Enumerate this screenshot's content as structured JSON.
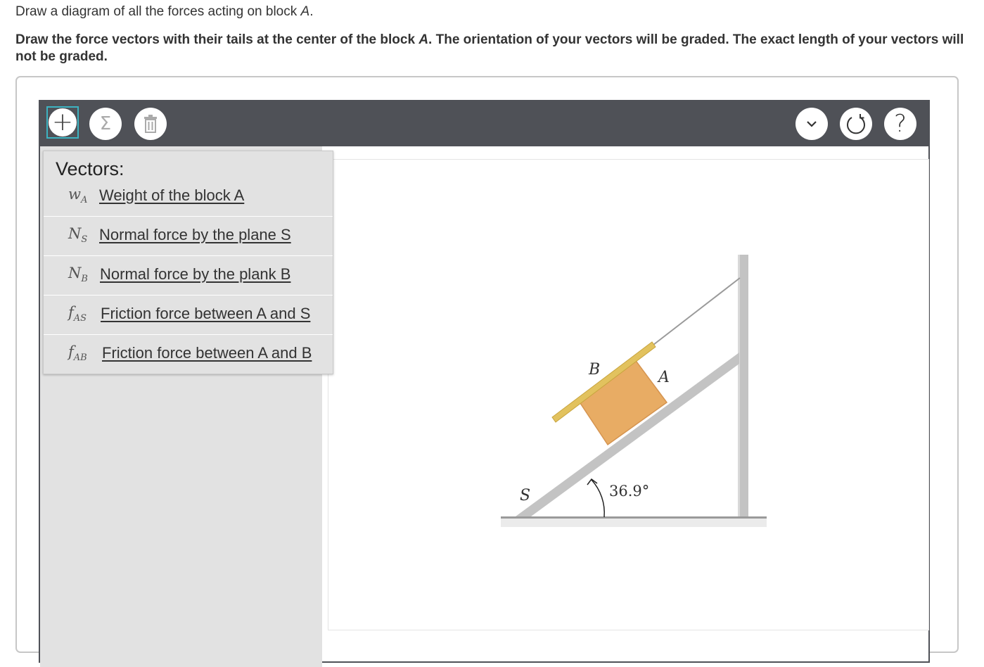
{
  "question": {
    "line1_prefix": "Draw a diagram of all the forces acting on block ",
    "line1_var": "A",
    "line1_suffix": ".",
    "line2_a": "Draw the force vectors with their tails at the center of the block ",
    "line2_var": "A",
    "line2_b": ". The orientation of your vectors will be graded. The exact length of your vectors will not be graded."
  },
  "toolbar": {
    "add_icon": "+",
    "sum_icon": "Σ",
    "trash_icon": "trash-icon",
    "chevron_icon": "chevron-down-icon",
    "reset_icon": "reset-icon",
    "help_icon": "?"
  },
  "menu": {
    "title": "Vectors:",
    "items": [
      {
        "sym": "w",
        "sub": "A",
        "label": "Weight of the block A"
      },
      {
        "sym": "N",
        "sub": "S",
        "label": "Normal force by the plane S"
      },
      {
        "sym": "N",
        "sub": "B",
        "label": "Normal force by the plank B"
      },
      {
        "sym": "f",
        "sub": "AS",
        "label": "Friction force between A and S"
      },
      {
        "sym": "f",
        "sub": "AB",
        "label": "Friction force between A and B"
      }
    ]
  },
  "figure": {
    "label_B": "B",
    "label_A": "A",
    "label_S": "S",
    "angle": "36.9°"
  },
  "colors": {
    "accent": "#3db3c1",
    "toolbar": "#4f5157",
    "block": "#e8ac64",
    "plank": "#e2c25e",
    "incline": "#c3c3c3"
  }
}
